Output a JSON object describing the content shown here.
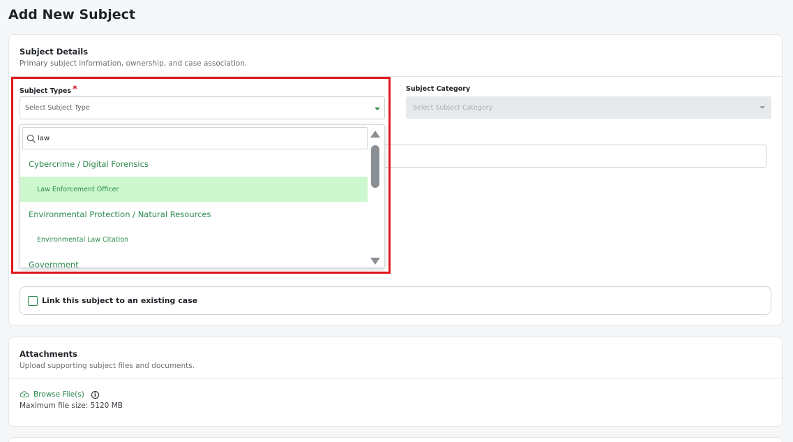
{
  "page": {
    "title": "Add New Subject"
  },
  "subject_details": {
    "title": "Subject Details",
    "subtitle": "Primary subject information, ownership, and case association.",
    "subject_types": {
      "label": "Subject Types",
      "required_mark": "*",
      "placeholder": "Select Subject Type"
    },
    "subject_category": {
      "label": "Subject Category",
      "placeholder": "Select Subject Category",
      "disabled": true
    },
    "dropdown": {
      "search_value": "law",
      "items": [
        {
          "kind": "group",
          "label": "Cybercrime / Digital Forensics"
        },
        {
          "kind": "option",
          "label": "Law Enforcement Officer",
          "active": true
        },
        {
          "kind": "group",
          "label": "Environmental Protection / Natural Resources"
        },
        {
          "kind": "option",
          "label": "Environmental Law Citation"
        },
        {
          "kind": "group",
          "label": "Government"
        }
      ]
    },
    "link_case": {
      "label": "Link this subject to an existing case",
      "checked": false
    }
  },
  "attachments": {
    "title": "Attachments",
    "subtitle": "Upload supporting subject files and documents.",
    "browse_label": "Browse File(s)",
    "info_glyph": "i",
    "max_size": "Maximum file size: 5120 MB"
  },
  "colors": {
    "accent": "#2c8a4e",
    "active_option_bg": "#cdf7cf",
    "highlight_border": "#e0161b",
    "required": "#d0021b"
  }
}
